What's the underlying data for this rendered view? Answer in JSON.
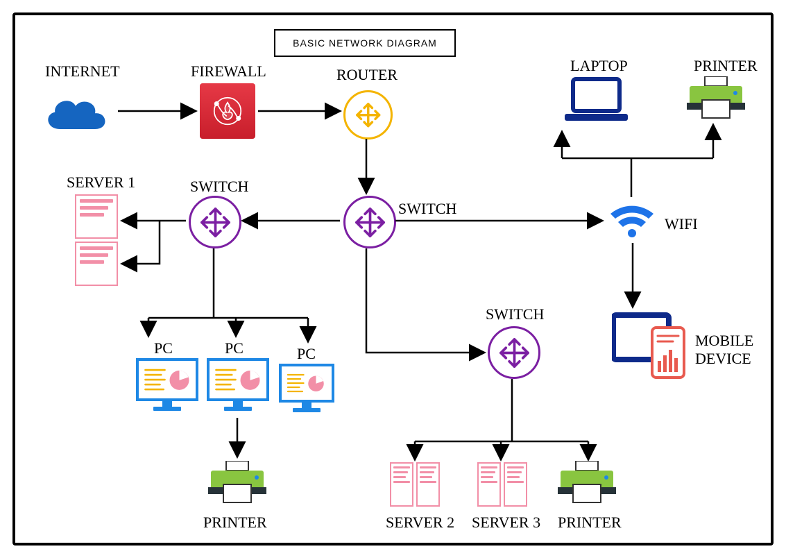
{
  "title": "BASIC NETWORK DIAGRAM",
  "nodes": {
    "internet": "INTERNET",
    "firewall": "FIREWALL",
    "router": "ROUTER",
    "switch": "SWITCH",
    "server1": "SERVER 1",
    "server2": "SERVER 2",
    "server3": "SERVER 3",
    "pc": "PC",
    "printer": "PRINTER",
    "laptop": "LAPTOP",
    "wifi": "WIFI",
    "mobile": "MOBILE DEVICE"
  },
  "colors": {
    "cloud": "#1565c0",
    "firewall_bg": "#e63946",
    "router_ring": "#f4b400",
    "switch_ring": "#7b1fa2",
    "pc_frame": "#1e88e5",
    "server_stroke": "#f28fa7",
    "printer_body": "#89c540",
    "wifi": "#1e73e8",
    "tablet": "#0e2a8a"
  },
  "edges": [
    [
      "internet",
      "firewall"
    ],
    [
      "firewall",
      "router"
    ],
    [
      "router",
      "switch_center"
    ],
    [
      "switch_center",
      "switch_left"
    ],
    [
      "switch_left",
      "server1_top"
    ],
    [
      "switch_left",
      "server1_bottom"
    ],
    [
      "switch_left",
      "pc1"
    ],
    [
      "switch_left",
      "pc2"
    ],
    [
      "switch_left",
      "pc3"
    ],
    [
      "pc2",
      "printer1"
    ],
    [
      "switch_center",
      "switch_bottom"
    ],
    [
      "switch_bottom",
      "server2"
    ],
    [
      "switch_bottom",
      "server3"
    ],
    [
      "switch_bottom",
      "printer2"
    ],
    [
      "switch_center",
      "wifi"
    ],
    [
      "wifi",
      "laptop"
    ],
    [
      "wifi",
      "printer3"
    ],
    [
      "wifi",
      "mobile_device"
    ]
  ]
}
